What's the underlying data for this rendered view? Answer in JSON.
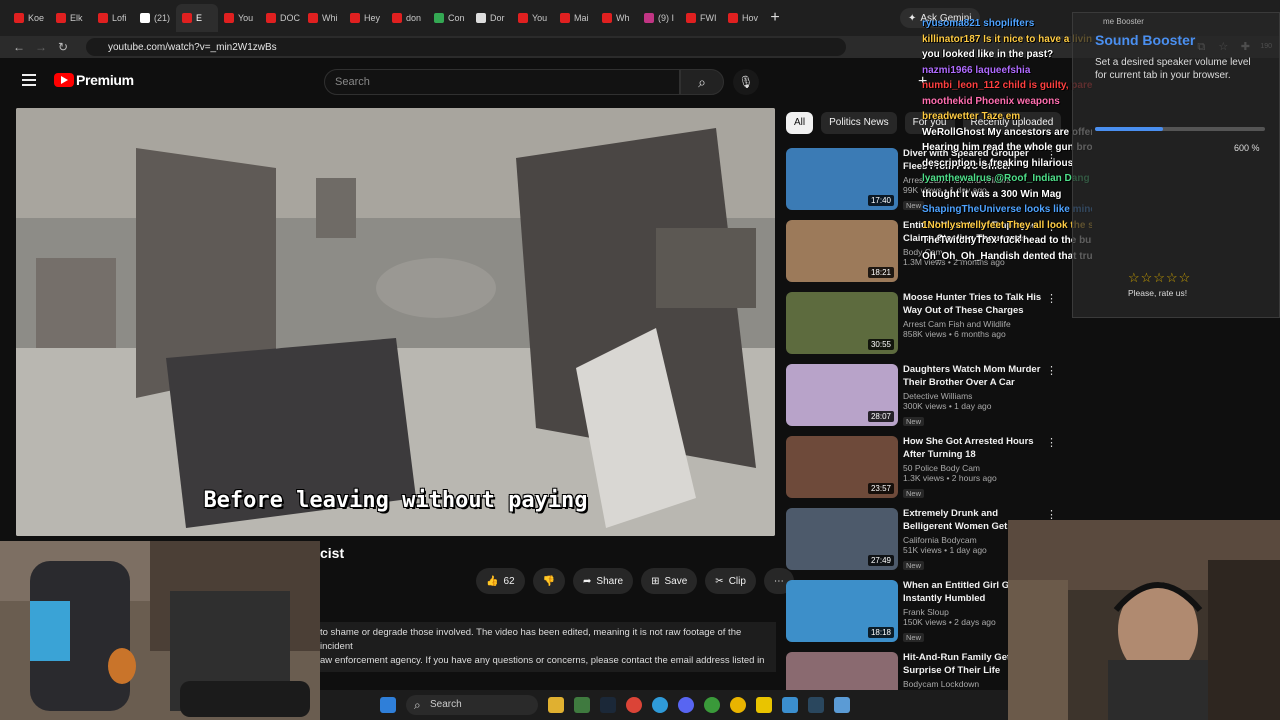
{
  "browser": {
    "tabs": [
      {
        "label": "Koe",
        "color": "#e02020"
      },
      {
        "label": "Elk",
        "color": "#e02020"
      },
      {
        "label": "Lofi",
        "color": "#e02020"
      },
      {
        "label": "(21)",
        "color": "#ffffff"
      },
      {
        "label": "E",
        "color": "#e02020"
      },
      {
        "label": "You",
        "color": "#e02020"
      },
      {
        "label": "DOC",
        "color": "#e02020"
      },
      {
        "label": "Whi",
        "color": "#e02020"
      },
      {
        "label": "Hey",
        "color": "#e02020"
      },
      {
        "label": "don",
        "color": "#e02020"
      },
      {
        "label": "Con",
        "color": "#34a853"
      },
      {
        "label": "Dor",
        "color": "#dddddd"
      },
      {
        "label": "You",
        "color": "#e02020"
      },
      {
        "label": "Mai",
        "color": "#e02020"
      },
      {
        "label": "Wh",
        "color": "#e02020"
      },
      {
        "label": "(9) I",
        "color": "#c13584"
      },
      {
        "label": "FWI",
        "color": "#e02020"
      },
      {
        "label": "Hov",
        "color": "#e02020"
      }
    ],
    "new_tab": "+",
    "gemini_label": "Ask Gemini",
    "url": "youtube.com/watch?v=_min2W1zwBs",
    "extension_badge": "190"
  },
  "youtube": {
    "brand": "Premium",
    "search_placeholder": "Search",
    "player_caption": "Before leaving without paying",
    "video_title_fragment": "cist",
    "actions": {
      "like_count": "62",
      "share": "Share",
      "save": "Save",
      "clip": "Clip"
    },
    "description_lines": [
      "to shame or degrade those involved. The video has been edited, meaning it is not raw footage of the incident",
      "aw enforcement agency. If you have any questions or concerns, please contact the email address listed in"
    ],
    "chips": [
      "All",
      "Politics News",
      "For you",
      "Recently uploaded"
    ],
    "recommendations": [
      {
        "title": "Diver with Speared Grouper Flees From FWC Officer",
        "channel": "Arrest Cam Fish and Wildlife",
        "stats": "99K views • 1 day ago",
        "badge": "New",
        "duration": "17:40",
        "thumb": "#3b7bb5"
      },
      {
        "title": "Entitled Nordstrom Employee Claims Stealing Thousands",
        "channel": "Body Cam",
        "stats": "1.3M views • 2 months ago",
        "badge": "",
        "duration": "18:21",
        "thumb": "#9c7a5a"
      },
      {
        "title": "Moose Hunter Tries to Talk His Way Out of These Charges",
        "channel": "Arrest Cam Fish and Wildlife",
        "stats": "858K views • 6 months ago",
        "badge": "",
        "duration": "30:55",
        "thumb": "#5d6b3e"
      },
      {
        "title": "Daughters Watch Mom Murder Their Brother Over A Car",
        "channel": "Detective Williams",
        "stats": "300K views • 1 day ago",
        "badge": "New",
        "duration": "28:07",
        "thumb": "#b8a3c9"
      },
      {
        "title": "How She Got Arrested Hours After Turning 18",
        "channel": "50 Police Body Cam",
        "stats": "1.3K views • 2 hours ago",
        "badge": "New",
        "duration": "23:57",
        "thumb": "#6e4a3a"
      },
      {
        "title": "Extremely Drunk and Belligerent Women Gets Placed in THE...",
        "channel": "California Bodycam",
        "stats": "51K views • 1 day ago",
        "badge": "New",
        "duration": "27:49",
        "thumb": "#4d5a6b"
      },
      {
        "title": "When an Entitled Girl Get Instantly Humbled",
        "channel": "Frank Sloup",
        "stats": "150K views • 2 days ago",
        "badge": "New",
        "duration": "18:18",
        "thumb": "#3d8fc9"
      },
      {
        "title": "Hit-And-Run Family Gets Surprise Of Their Life",
        "channel": "Bodycam Lockdown",
        "stats": "",
        "badge": "",
        "duration": "",
        "thumb": "#8a6a70"
      }
    ]
  },
  "chat": [
    {
      "text": "ryusoma821  shoplifters",
      "color": "#4fa3ff"
    },
    {
      "text": "killinator187  Is it nice to have a living reminder of what",
      "color": "#ffcc44"
    },
    {
      "text": "you looked like in the past?",
      "color": "#ffffff"
    },
    {
      "text": "nazmi1966  laqueefshia",
      "color": "#b06cff"
    },
    {
      "text": "numbi_leon_112  child is guilty, parent",
      "color": "#ff4040"
    },
    {
      "text": "moothekid  Phoenix weapons",
      "color": "#ff6fb0"
    },
    {
      "text": "breadwetter  Taze em",
      "color": "#ffcc44"
    },
    {
      "text": "WeRollGhost  My ancestors are offended",
      "color": "#ffffff"
    },
    {
      "text": "Hearing him read the whole gun broker",
      "color": "#ffffff"
    },
    {
      "text": "description is freaking hilarious",
      "color": "#ffffff"
    },
    {
      "text": "lyamthewalrus  @Roof_Indian Dang I knew it",
      "color": "#4fe08a"
    },
    {
      "text": "thought it was a 300 Win Mag",
      "color": "#ffffff"
    },
    {
      "text": "ShapingTheUniverse  looks like mine too",
      "color": "#4fa3ff"
    },
    {
      "text": "1Nonlysmellyfeet  They all look the same",
      "color": "#ffcc44"
    },
    {
      "text": "TheTwitchyTrex  fuck head to the bumper",
      "color": "#ffffff"
    },
    {
      "text": "Oh_Oh_Oh_Handish  dented that truck",
      "color": "#ffffff"
    }
  ],
  "booster": {
    "header": "me Booster",
    "title": "Sound Booster",
    "description": "Set a desired speaker volume level for current tab in your browser.",
    "level_percent": 40,
    "max_label": "600 %",
    "rate_label": "Please, rate us!",
    "stars": "☆☆☆☆☆"
  },
  "taskbar": {
    "search_label": "Search"
  }
}
